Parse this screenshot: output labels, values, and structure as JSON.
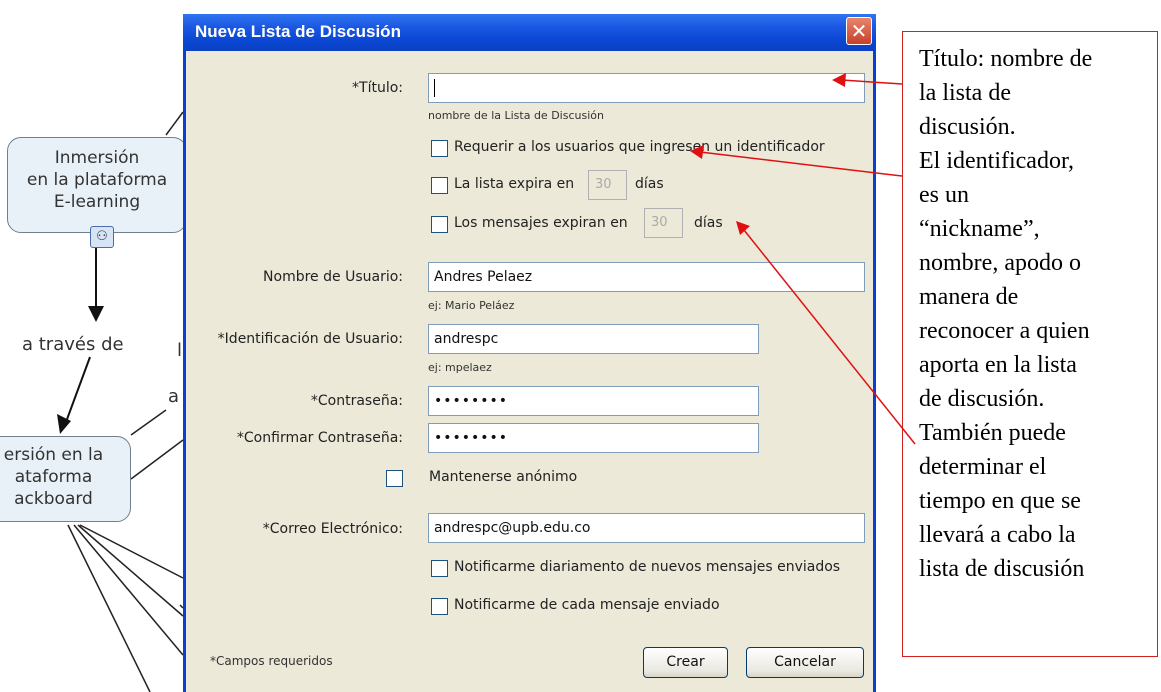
{
  "concept_map": {
    "node_1_lines": [
      "Inmersión",
      "en la plataforma",
      "E-learning"
    ],
    "node_2_lines": [
      "ersión en la",
      "ataforma",
      "ackboard"
    ],
    "link_label": "a través de",
    "fragment_1": "l",
    "fragment_2": "a"
  },
  "dialog": {
    "title": "Nueva Lista de Discusión",
    "close_label": "✕",
    "title_field": {
      "label": "*Título:",
      "value": "",
      "hint": "nombre de la Lista de Discusión"
    },
    "require_identifier": {
      "label": "Requerir a los usuarios que ingresen un identificador",
      "checked": false
    },
    "list_expires": {
      "label": "La lista expira en",
      "days": "30",
      "unit": "días",
      "checked": false
    },
    "messages_expire": {
      "label": "Los mensajes expiran en",
      "days": "30",
      "unit": "días",
      "checked": false
    },
    "username": {
      "label": "Nombre de Usuario:",
      "value": "Andres Pelaez",
      "hint": "ej: Mario Peláez"
    },
    "user_id": {
      "label": "*Identificación de Usuario:",
      "value": "andrespc",
      "hint": "ej: mpelaez"
    },
    "password": {
      "label": "*Contraseña:",
      "value": "••••••••"
    },
    "confirm_password": {
      "label": "*Confirmar Contraseña:",
      "value": "••••••••"
    },
    "anonymous": {
      "label": "Mantenerse anónimo",
      "checked": false
    },
    "email": {
      "label": "*Correo Electrónico:",
      "value": "andrespc@upb.edu.co"
    },
    "notify_daily": {
      "label": "Notificarme diariamento de nuevos mensajes enviados",
      "checked": false
    },
    "notify_each": {
      "label": "Notificarme de cada mensaje enviado",
      "checked": false
    },
    "required_note": "*Campos requeridos",
    "create_label": "Crear",
    "cancel_label": "Cancelar"
  },
  "annotation": {
    "lines": [
      "Título: nombre de",
      "la lista de",
      "discusión.",
      "El identificador,",
      "es un",
      "“nickname”,",
      "nombre, apodo o",
      "manera de",
      "reconocer a quien",
      "aporta en la lista",
      "de discusión.",
      "También puede",
      "determinar el",
      "tiempo en que se",
      "llevará a cabo la",
      "lista de discusión"
    ]
  },
  "colors": {
    "titlebar": "#0a47d4",
    "dialog_bg": "#ece9d8",
    "arrow": "#e01010",
    "node_fill": "#e8f1f7"
  }
}
